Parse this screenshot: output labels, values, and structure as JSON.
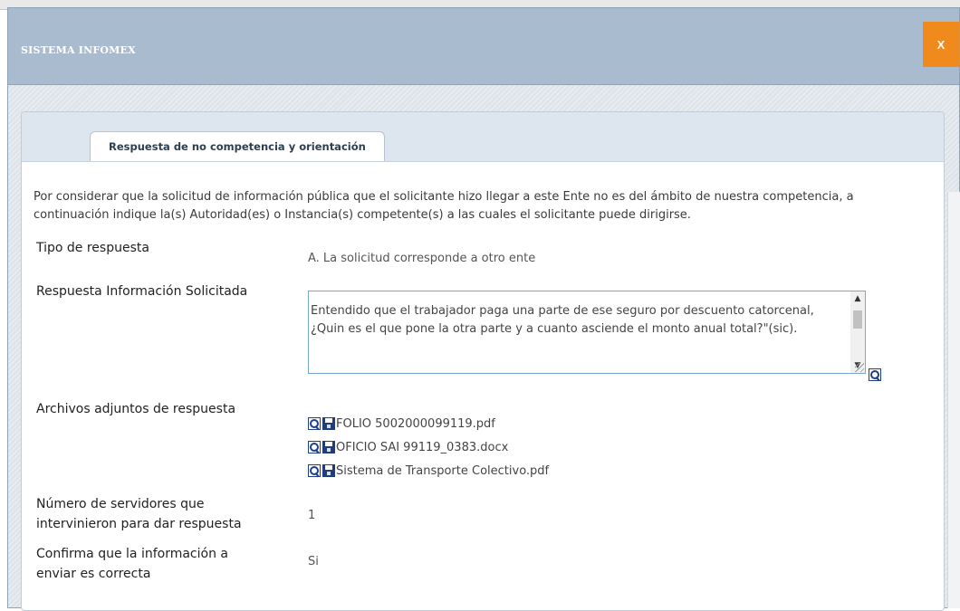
{
  "window": {
    "title": "SISTEMA INFOMEX",
    "close_label": "X"
  },
  "tabs": [
    {
      "label": "Respuesta de no competencia y orientación",
      "active": true
    }
  ],
  "intro_text": "Por considerar que la solicitud de información pública que el solicitante hizo llegar a este Ente no es del ámbito de nuestra competencia, a continuación indique la(s) Autoridad(es) o Instancia(s) competente(s) a las cuales el solicitante puede dirigirse.",
  "fields": {
    "tipo_respuesta": {
      "label": "Tipo de respuesta",
      "value": "A. La solicitud corresponde a otro ente"
    },
    "respuesta_info": {
      "label": "Respuesta Información Solicitada",
      "value": "Entendido que el trabajador paga una parte de ese seguro por descuento catorcenal, ¿Quin es el que pone la otra parte y a cuanto asciende el monto anual total?\"(sic)."
    },
    "archivos": {
      "label": "Archivos adjuntos de respuesta",
      "files": [
        "FOLIO 5002000099119.pdf",
        "OFICIO SAI 99119_0383.docx",
        "Sistema de Transporte Colectivo.pdf"
      ]
    },
    "servidores": {
      "label_line1": "Número de servidores que",
      "label_line2": "intervinieron para dar respuesta",
      "value": "1"
    },
    "confirma": {
      "label_line1": "Confirma que la información a",
      "label_line2": "enviar es correcta",
      "value": "Si"
    }
  },
  "colors": {
    "title_bar": "#a9bccf",
    "close_button": "#f08a1c",
    "tab_strip": "#dde6ef"
  }
}
